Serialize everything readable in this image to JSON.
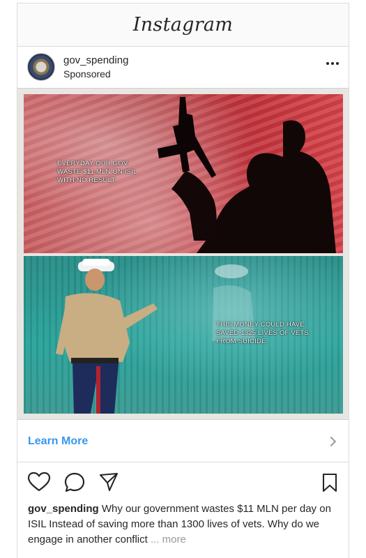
{
  "app": {
    "title": "Instagram"
  },
  "post": {
    "username": "gov_spending",
    "label": "Sponsored",
    "image_text_top": "EVERYDAY OUR GOV. WASTE $11 MLN ON ISIL WITH NO RESULT.",
    "image_text_bottom": "THIS MONEY COULD HAVE SAVED 1325 LIVES OF VETS FROM SUICIDE.",
    "cta_label": "Learn More",
    "caption_user": "gov_spending",
    "caption_text": "Why our government wastes $11 MLN per day on ISIL Instead of saving more than 1300 lives of vets. Why do we engage in another conflict",
    "caption_ellipsis": "... more"
  },
  "icons": {
    "like": "heart-icon",
    "comment": "comment-icon",
    "share": "send-icon",
    "save": "bookmark-icon",
    "options": "more-options-icon",
    "cta_arrow": "chevron-right-icon"
  },
  "colors": {
    "link_blue": "#3897f0",
    "text": "#262626",
    "border": "#dbdbdb",
    "muted": "#999999"
  }
}
